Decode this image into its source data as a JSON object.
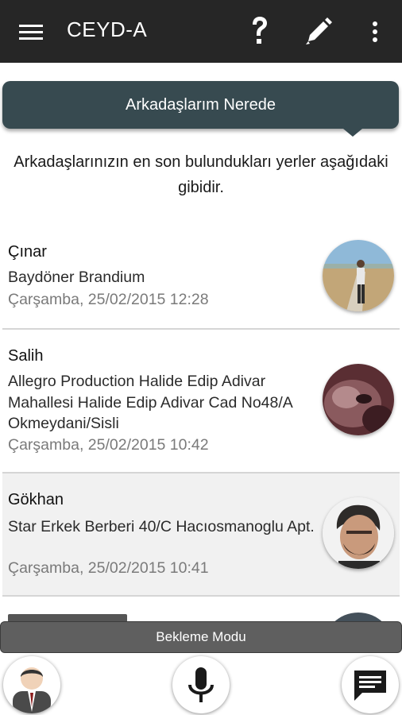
{
  "appbar": {
    "title": "CEYD-A",
    "icons": [
      "menu-icon",
      "help-icon",
      "edit-icon",
      "more-vert-icon"
    ]
  },
  "card": {
    "title": "Arkadaşlarım Nerede"
  },
  "description": "Arkadaşlarınızın en son bulundukları yerler aşağıdaki gibidir.",
  "friends": [
    {
      "name": "Çınar",
      "address": "Baydöner Brandium",
      "date": "Çarşamba, 25/02/2015 12:28"
    },
    {
      "name": "Salih",
      "address": "Allegro Production Halide Edip Adivar Mahallesi Halide Edip Adivar Cad No48/A Okmeydani/Sisli",
      "date": "Çarşamba, 25/02/2015 10:42"
    },
    {
      "name": "Gökhan",
      "address": "Star Erkek Berberi 40/C Hacıosmanoglu Apt.",
      "date": "Çarşamba, 25/02/2015 10:41"
    }
  ],
  "standby_label": "Bekleme Modu",
  "bottom_actions": [
    "profile-icon",
    "microphone-icon",
    "chat-icon"
  ],
  "colors": {
    "appbar": "#262626",
    "card": "#374a50",
    "divider": "#d5d5d5",
    "selected_row": "#f1f1f1",
    "standby": "#5f5f5f"
  }
}
